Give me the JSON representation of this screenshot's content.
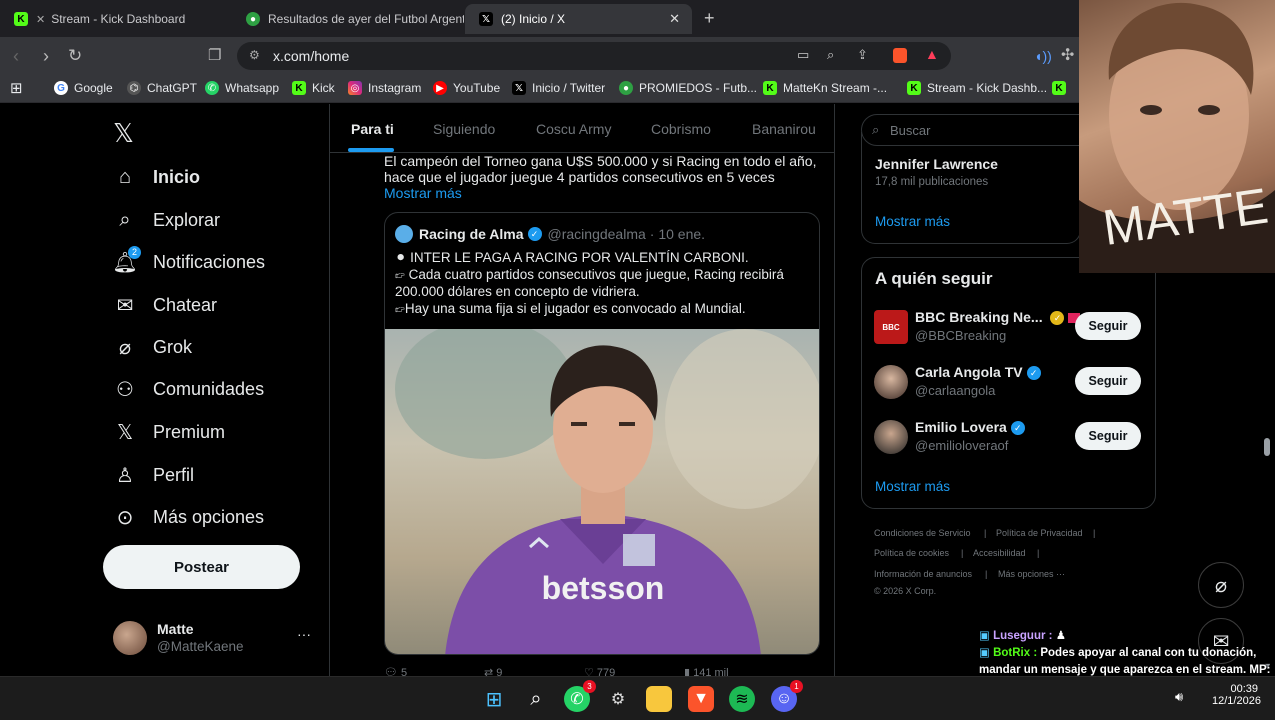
{
  "browser": {
    "tabs": [
      {
        "label": "Stream - Kick Dashboard",
        "icon": "kick-icon"
      },
      {
        "label": "Resultados de ayer del Futbol Argent",
        "icon": "promiedos-icon"
      },
      {
        "label": "(2) Inicio / X",
        "icon": "x-icon"
      }
    ],
    "url": "x.com/home",
    "bookmarks": [
      {
        "label": "Google"
      },
      {
        "label": "ChatGPT"
      },
      {
        "label": "Whatsapp"
      },
      {
        "label": "Kick"
      },
      {
        "label": "Instagram"
      },
      {
        "label": "YouTube"
      },
      {
        "label": "Inicio / Twitter"
      },
      {
        "label": "PROMIEDOS - Futb..."
      },
      {
        "label": "MatteKn Stream -..."
      },
      {
        "label": "Stream - Kick Dashb..."
      }
    ]
  },
  "sidebar": {
    "items": [
      {
        "label": "Inicio",
        "icon": "home-icon"
      },
      {
        "label": "Explorar",
        "icon": "search-icon"
      },
      {
        "label": "Notificaciones",
        "icon": "bell-icon",
        "badge": "2"
      },
      {
        "label": "Chatear",
        "icon": "mail-icon"
      },
      {
        "label": "Grok",
        "icon": "grok-icon"
      },
      {
        "label": "Comunidades",
        "icon": "communities-icon"
      },
      {
        "label": "Premium",
        "icon": "x-icon"
      },
      {
        "label": "Perfil",
        "icon": "person-icon"
      },
      {
        "label": "Más opciones",
        "icon": "more-icon"
      }
    ],
    "post_button": "Postear",
    "account": {
      "name": "Matte",
      "handle": "@MatteKaene",
      "more": "···"
    }
  },
  "feed": {
    "tabs": [
      "Para ti",
      "Siguiendo",
      "Coscu Army",
      "Cobrismo",
      "Bananirou"
    ],
    "tweet_text": "El campeón del Torneo gana U$S 500.000 y si Racing en todo el año, hace que el jugador juegue 4 partidos consecutivos en 5 veces",
    "show_more": "Mostrar más",
    "quote": {
      "name": "Racing de Alma",
      "handle": "@racingdealma",
      "date": "· 10 ene.",
      "line1": "INTER LE PAGA A RACING POR VALENTÍN CARBONI.",
      "line2": "Cada cuatro partidos consecutivos que juegue, Racing recibirá 200.000 dólares en concepto de vidriera.",
      "line3": "Hay una suma fija si el jugador es convocado al Mundial.",
      "image_text": "betsson"
    },
    "actions": {
      "replies": "5",
      "retweets": "9",
      "likes": "779",
      "views": "141 mil"
    }
  },
  "right": {
    "search_placeholder": "Buscar",
    "trend": {
      "name": "Jennifer Lawrence",
      "count": "17,8 mil publicaciones",
      "show_more": "Mostrar más"
    },
    "who_title": "A quién seguir",
    "who": [
      {
        "name": "BBC Breaking Ne...",
        "handle": "@BBCBreaking",
        "follow": "Seguir"
      },
      {
        "name": "Carla Angola TV",
        "handle": "@carlaangola",
        "follow": "Seguir"
      },
      {
        "name": "Emilio Lovera",
        "handle": "@emilioloveraof",
        "follow": "Seguir"
      }
    ],
    "who_more": "Mostrar más",
    "footer": {
      "terms": "Condiciones de Servicio",
      "privacy": "Política de Privacidad",
      "cookies": "Política de cookies",
      "accessibility": "Accesibilidad",
      "ads": "Información de anuncios",
      "more": "Más opciones ···",
      "copyright": "© 2026 X Corp."
    }
  },
  "overlay": {
    "webcam_text": "MATTE",
    "chat": [
      {
        "user": "Luseguur :",
        "text": ""
      },
      {
        "user": "BotRix :",
        "text": "Podes apoyar al canal con tu donación, mandar un mensaje y que aparezca en el stream. MP: https://ceneka.net/MatteKn PayPal: https://streamlabs.com/mattekn/tip"
      }
    ]
  },
  "taskbar": {
    "time": "00:39",
    "date": "12/1/2026",
    "whatsapp_badge": "3",
    "discord_badge": "1"
  }
}
